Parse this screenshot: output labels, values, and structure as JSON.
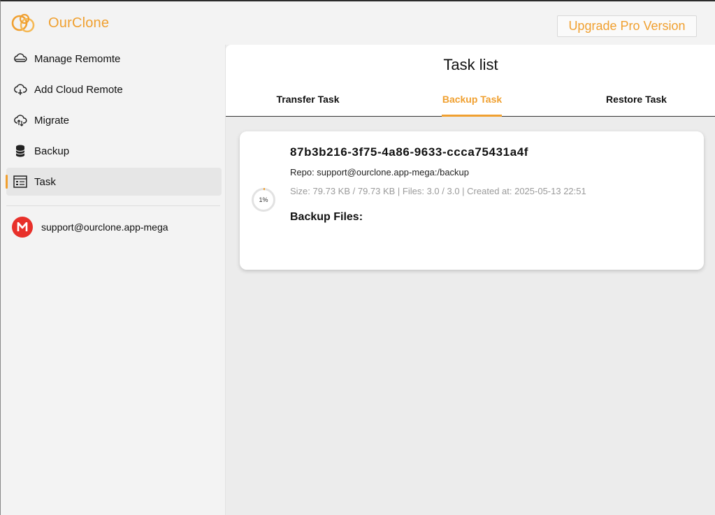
{
  "app": {
    "title": "OurClone",
    "upgrade_label": "Upgrade Pro Version",
    "accent": "#f0a030"
  },
  "sidebar": {
    "items": [
      {
        "label": "Manage Remomte",
        "icon": "cloud-stack-icon"
      },
      {
        "label": "Add Cloud Remote",
        "icon": "cloud-add-icon"
      },
      {
        "label": "Migrate",
        "icon": "cloud-sync-icon"
      },
      {
        "label": "Backup",
        "icon": "database-icon"
      },
      {
        "label": "Task",
        "icon": "task-list-icon",
        "active": true
      }
    ],
    "account": {
      "label": "support@ourclone.app-mega",
      "icon": "mega-icon",
      "color": "#e8302a"
    }
  },
  "main": {
    "title": "Task list",
    "tabs": [
      {
        "label": "Transfer Task"
      },
      {
        "label": "Backup Task",
        "active": true
      },
      {
        "label": "Restore Task"
      }
    ]
  },
  "task": {
    "id": "87b3b216-3f75-4a86-9633-ccca75431a4f",
    "repo": "Repo: support@ourclone.app-mega:/backup",
    "meta": "Size: 79.73 KB / 79.73 KB | Files: 3.0 / 3.0 | Created at: 2025-05-13 22:51",
    "progress_label": "1%",
    "progress_value": 0.01,
    "files_heading": "Backup Files:"
  }
}
